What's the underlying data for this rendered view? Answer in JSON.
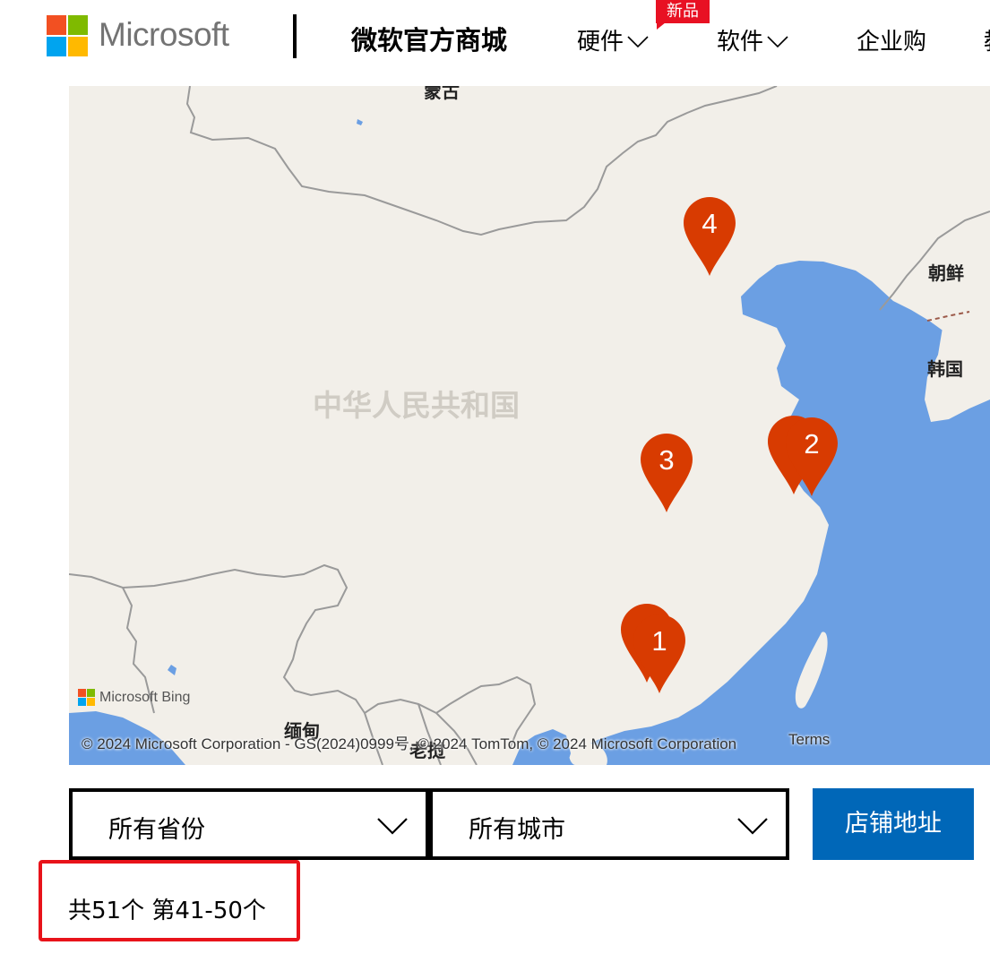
{
  "header": {
    "brand": "Microsoft",
    "store_title": "微软官方商城",
    "nav": [
      {
        "label": "硬件"
      },
      {
        "label": "软件"
      },
      {
        "label": "企业购"
      },
      {
        "label": "教"
      }
    ],
    "new_badge": "新品"
  },
  "map": {
    "labels": {
      "mongolia": "蒙古",
      "north_korea": "朝鲜",
      "south_korea": "韩国",
      "china": "中华人民共和国",
      "myanmar": "缅甸",
      "laos": "老挝"
    },
    "pins": [
      {
        "number": "4"
      },
      {
        "number": "3"
      },
      {
        "number": "1"
      },
      {
        "number": "2"
      },
      {
        "number": "1"
      },
      {
        "number": "2"
      }
    ],
    "bing_text": "Microsoft Bing",
    "copyright": "© 2024 Microsoft Corporation - GS(2024)0999号, © 2024 TomTom, © 2024 Microsoft Corporation",
    "terms": "Terms"
  },
  "filters": {
    "province": "所有省份",
    "city": "所有城市",
    "address_button": "店铺地址"
  },
  "results": {
    "summary": "共51个 第41-50个"
  },
  "colors": {
    "pin": "#d83b01",
    "primary_button": "#0067b8",
    "badge": "#e81123",
    "highlight_box": "#e8131a",
    "land": "#f2efe9",
    "water": "#6b9fe3"
  }
}
